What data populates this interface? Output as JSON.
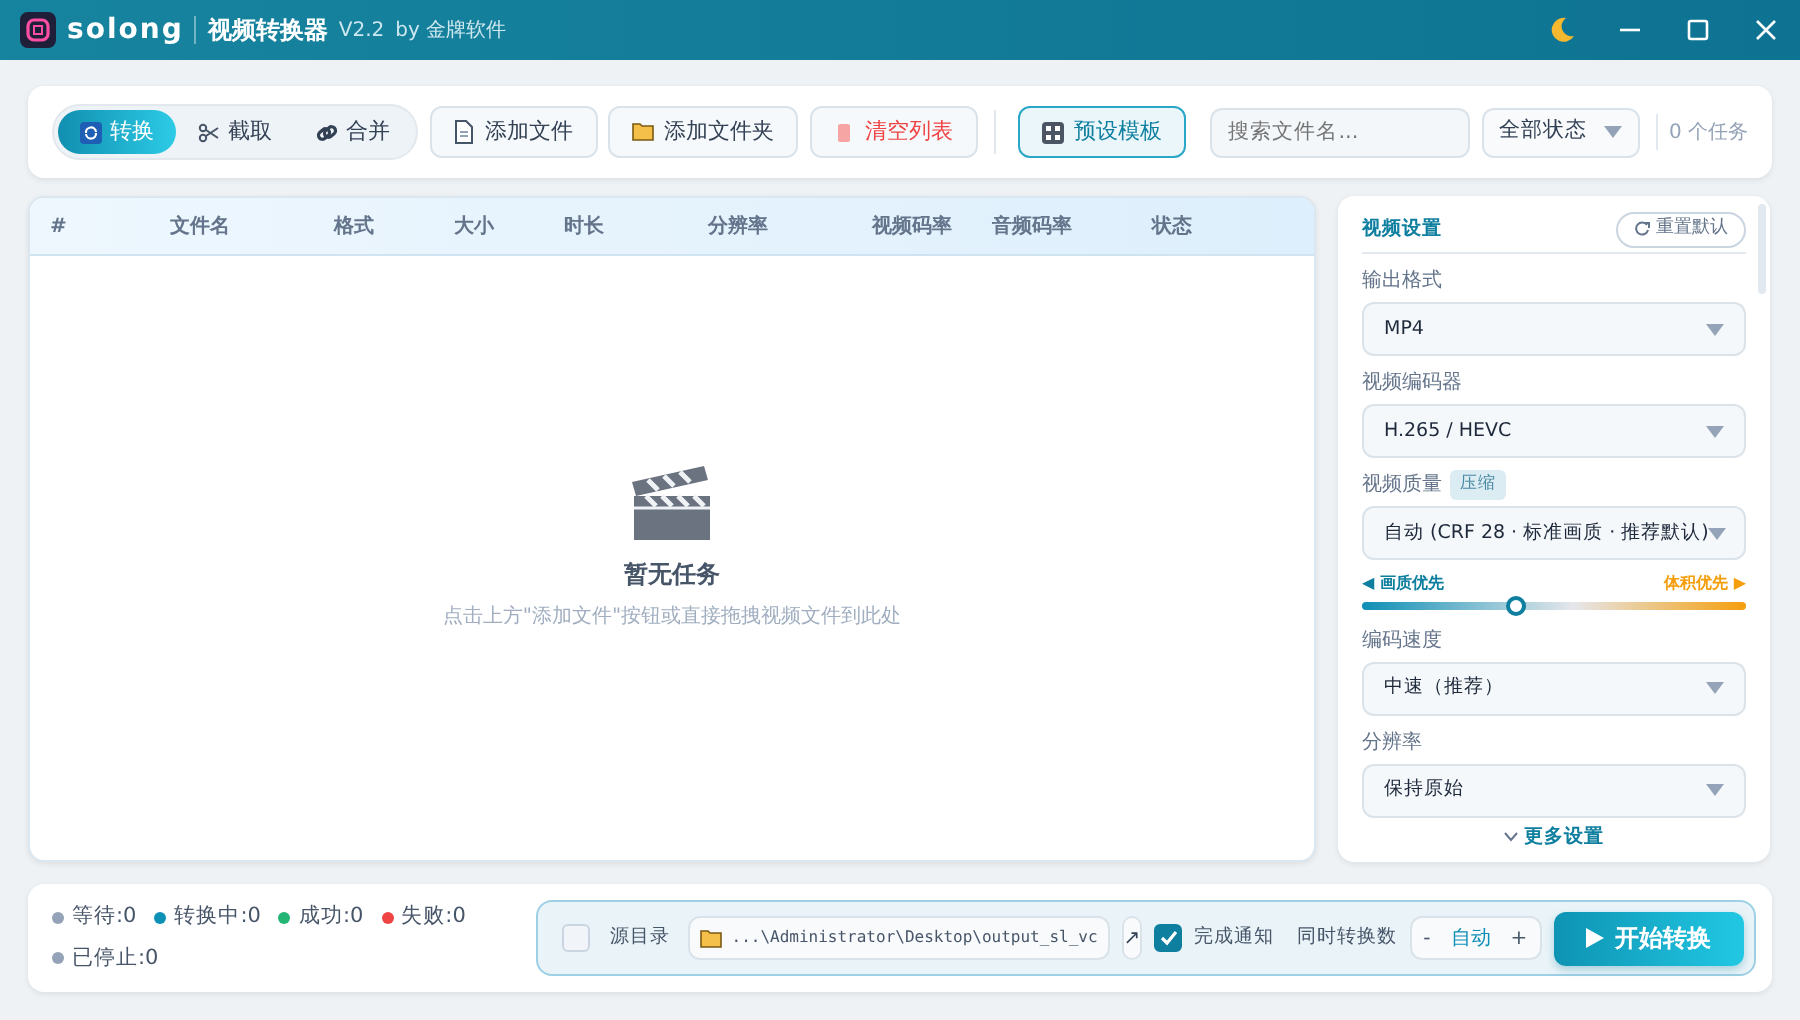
{
  "window": {
    "app_name": "solong",
    "title": "视频转换器",
    "version": "V2.2",
    "vendor": "by 金牌软件"
  },
  "toolbar": {
    "modes": [
      {
        "label": "转换",
        "kind": "refresh",
        "selected": true
      },
      {
        "label": "截取",
        "kind": "scissors",
        "selected": false
      },
      {
        "label": "合并",
        "kind": "link",
        "selected": false
      }
    ],
    "buttons": [
      {
        "label": "添加文件",
        "kind": "file"
      },
      {
        "label": "添加文件夹",
        "kind": "folder"
      },
      {
        "label": "清空列表",
        "kind": "danger"
      }
    ],
    "preset_button": "预设模板",
    "search": {
      "placeholder": "搜索文件名..."
    },
    "status_filter": "全部状态",
    "task_count": "0 个任务"
  },
  "table": {
    "columns": [
      "#",
      "文件名",
      "格式",
      "大小",
      "时长",
      "分辨率",
      "视频码率",
      "音频码率",
      "状态"
    ],
    "empty_title": "暂无任务",
    "empty_hint": "点击上方\"添加文件\"按钮或直接拖拽视频文件到此处"
  },
  "settings": {
    "title": "视频设置",
    "reset_button": "重置默认",
    "fields": [
      {
        "label": "输出格式",
        "value": "MP4"
      },
      {
        "label": "视频编码器",
        "value": "H.265 / HEVC"
      },
      {
        "label": "视频质量",
        "badge": "压缩",
        "value": "自动 (CRF 28 · 标准画质 · 推荐默认)",
        "slider": {
          "left": "◀ 画质优先",
          "right": "体积优先 ▶",
          "level": 0.4
        }
      },
      {
        "label": "编码速度",
        "value": "中速（推荐）"
      },
      {
        "label": "分辨率",
        "value": "保持原始"
      }
    ],
    "more_link": "更多设置"
  },
  "status_bar": {
    "counts": [
      {
        "label": "等待:0",
        "color": "#94a3b8"
      },
      {
        "label": "转换中:0",
        "color": "#0e8fb5"
      },
      {
        "label": "成功:0",
        "color": "#22b573"
      },
      {
        "label": "失败:0",
        "color": "#ef4444"
      },
      {
        "label": "已停止:0",
        "color": "#94a3b8"
      }
    ],
    "source_dir": {
      "label": "源目录",
      "checked": false
    },
    "output_path": "...\\Administrator\\Desktop\\output_sl_vc",
    "open_button": "↗",
    "notify": {
      "label": "完成通知",
      "checked": true
    },
    "concurrency": {
      "label": "同时转换数",
      "minus": "-",
      "value": "自动",
      "plus": "+"
    },
    "start_button": "开始转换"
  }
}
